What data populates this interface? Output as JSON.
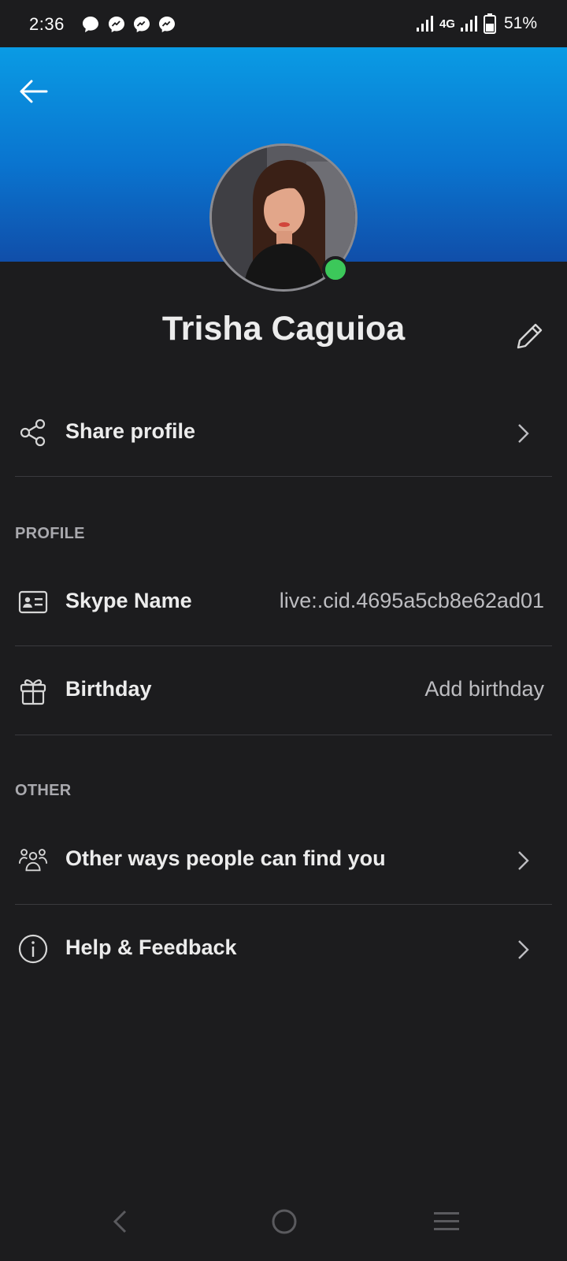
{
  "status_bar": {
    "time": "2:36",
    "network": "4G",
    "battery": "51%",
    "notification_icons": [
      "chat-bubble-icon",
      "messenger-icon",
      "messenger-icon",
      "messenger-icon"
    ]
  },
  "colors": {
    "header_top": "#0a9be4",
    "header_bottom": "#104ea9",
    "background": "#1c1c1e",
    "presence_online": "#3cc85a"
  },
  "profile": {
    "display_name": "Trisha Caguioa",
    "presence": "online"
  },
  "share_profile": {
    "label": "Share profile"
  },
  "sections": {
    "profile": "PROFILE",
    "other": "OTHER"
  },
  "skype_name": {
    "label": "Skype Name",
    "value": "live:.cid.4695a5cb8e62ad01"
  },
  "birthday": {
    "label": "Birthday",
    "value": "Add birthday"
  },
  "other_ways": {
    "label": "Other ways people can find you"
  },
  "help": {
    "label": "Help & Feedback"
  }
}
